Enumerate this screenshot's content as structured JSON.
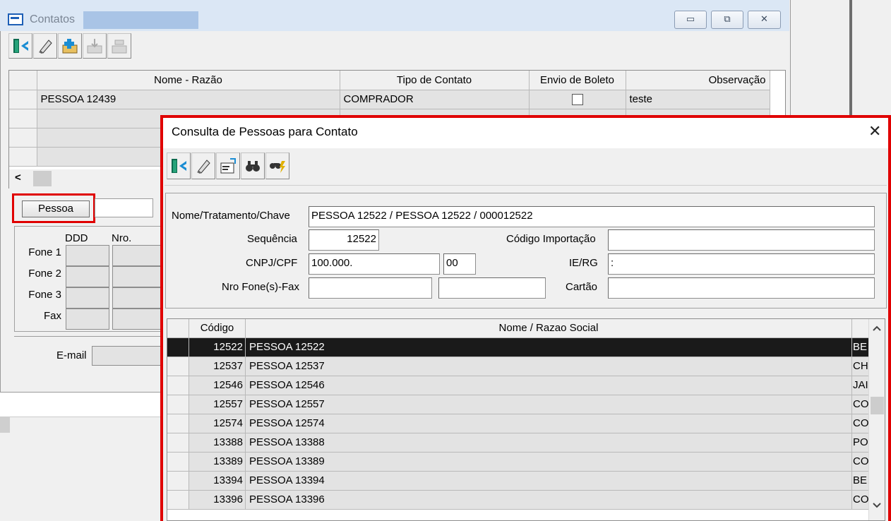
{
  "background_window": {
    "title": "Contatos",
    "buttons": {
      "minimize": "▭",
      "restore": "⧉",
      "close": "✕"
    },
    "toolbar": [
      "exit-door-icon",
      "eraser-icon",
      "add-folder-icon",
      "import-disabled-icon",
      "export-disabled-icon"
    ],
    "grid": {
      "columns": [
        "Nome - Razão",
        "Tipo de Contato",
        "Envio de Boleto",
        "Observação"
      ],
      "rows": [
        {
          "nome": "PESSOA 12439",
          "tipo": "COMPRADOR",
          "envio": "",
          "obs": "teste"
        }
      ],
      "scroll_left": "<"
    },
    "pessoa_button": "Pessoa",
    "phones": {
      "col_ddd": "DDD",
      "col_nro": "Nro.",
      "labels": [
        "Fone 1",
        "Fone 2",
        "Fone 3",
        "Fax"
      ]
    },
    "email_label": "E-mail"
  },
  "dialog": {
    "title": "Consulta de Pessoas para Contato",
    "close": "✕",
    "toolbar": [
      "exit-door-icon",
      "eraser-icon",
      "load-card-icon",
      "binoculars-icon",
      "binoculars-fast-icon"
    ],
    "fields": {
      "nome_label": "Nome/Tratamento/Chave",
      "nome_value": "PESSOA 12522 / PESSOA 12522 / 000012522",
      "sequencia_label": "Sequência",
      "sequencia_value": "12522",
      "codigo_importacao_label": "Código Importação",
      "codigo_importacao_value": "",
      "cnpj_label": "CNPJ/CPF",
      "cnpj_value": "100.000.",
      "cnpj_suffix": "00",
      "ie_label": "IE/RG",
      "ie_value": ":",
      "fone_label": "Nro Fone(s)-Fax",
      "fone_value_1": "",
      "fone_value_2": "",
      "cartao_label": "Cartão",
      "cartao_value": ""
    },
    "results": {
      "columns": [
        "Código",
        "Nome / Razao Social"
      ],
      "rows": [
        {
          "codigo": "12522",
          "nome": "PESSOA 12522",
          "extra": "BE"
        },
        {
          "codigo": "12537",
          "nome": "PESSOA 12537",
          "extra": "CH"
        },
        {
          "codigo": "12546",
          "nome": "PESSOA 12546",
          "extra": "JAI"
        },
        {
          "codigo": "12557",
          "nome": "PESSOA 12557",
          "extra": "CO"
        },
        {
          "codigo": "12574",
          "nome": "PESSOA 12574",
          "extra": "CO"
        },
        {
          "codigo": "13388",
          "nome": "PESSOA 13388",
          "extra": "PO"
        },
        {
          "codigo": "13389",
          "nome": "PESSOA 13389",
          "extra": "CO"
        },
        {
          "codigo": "13394",
          "nome": "PESSOA 13394",
          "extra": "BE"
        },
        {
          "codigo": "13396",
          "nome": "PESSOA 13396",
          "extra": "CO"
        }
      ],
      "selected_index": 0,
      "scroll_up": "^",
      "scroll_down": "v"
    }
  },
  "colors": {
    "highlight": "#e00000",
    "selected_row": "#1a1a1a",
    "title_bar": "#dbe7f5"
  }
}
